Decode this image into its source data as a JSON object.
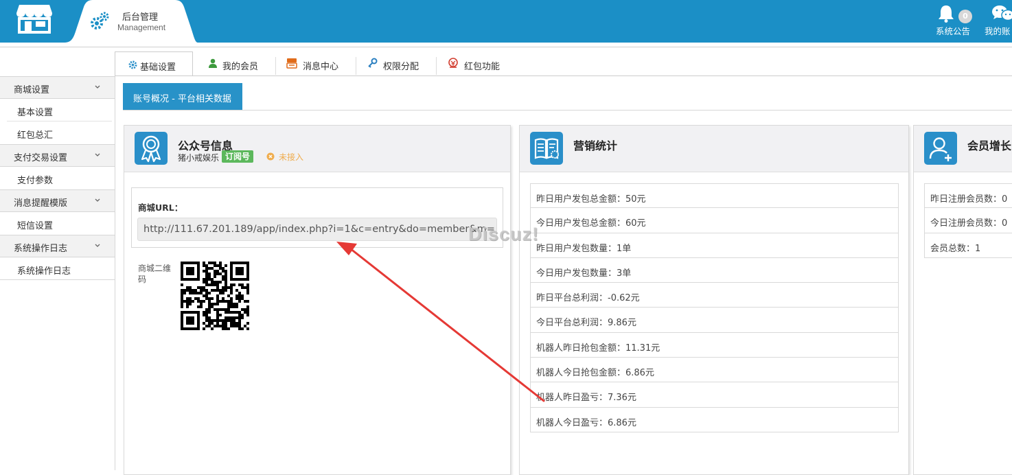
{
  "header": {
    "mgmt_title": "后台管理",
    "mgmt_subtitle": "Management",
    "notice_label": "系统公告",
    "notice_count": "0",
    "wechat_label": "我的账"
  },
  "tabs": [
    {
      "label": "基础设置",
      "icon": "gear-icon",
      "active": true
    },
    {
      "label": "我的会员",
      "icon": "user-icon"
    },
    {
      "label": "消息中心",
      "icon": "message-icon"
    },
    {
      "label": "权限分配",
      "icon": "key-icon"
    },
    {
      "label": "红包功能",
      "icon": "redpacket-icon"
    }
  ],
  "sidebar": {
    "groups": [
      {
        "label": "商城设置",
        "items": [
          "基本设置",
          "红包总汇"
        ]
      },
      {
        "label": "支付交易设置",
        "items": [
          "支付参数"
        ]
      },
      {
        "label": "消息提醒模版",
        "items": [
          "短信设置"
        ]
      },
      {
        "label": "系统操作日志",
        "items": [
          "系统操作日志"
        ]
      }
    ]
  },
  "section_tab": "账号概况 - 平台相关数据",
  "account_panel": {
    "title": "公众号信息",
    "name": "猪小戒娱乐",
    "type_badge": "订阅号",
    "status": "未接入",
    "url_label": "商城URL：",
    "url_value": "http://111.67.201.189/app/index.php?i=1&c=entry&do=member&m=",
    "qr_label": "商城二维码"
  },
  "marketing_panel": {
    "title": "营销统计",
    "rows": [
      "昨日用户发包总金额：50元",
      "今日用户发包总金额：60元",
      "昨日用户发包数量：1单",
      "今日用户发包数量：3单",
      "昨日平台总利润：-0.62元",
      "今日平台总利润：9.86元",
      "机器人昨日抢包金额：11.31元",
      "机器人今日抢包金额：6.86元",
      "机器人昨日盈亏：7.36元",
      "机器人今日盈亏：6.86元"
    ]
  },
  "member_panel": {
    "title": "会员增长",
    "rows": [
      "昨日注册会员数：0",
      "今日注册会员数：0",
      "会员总数：1"
    ]
  },
  "watermark": "Discuz!",
  "colors": {
    "topbar": "#1b8fc6",
    "accent": "#2892c8",
    "badge_green": "#5cb85c",
    "warning": "#f0ad4e",
    "arrow": "#e53935"
  }
}
